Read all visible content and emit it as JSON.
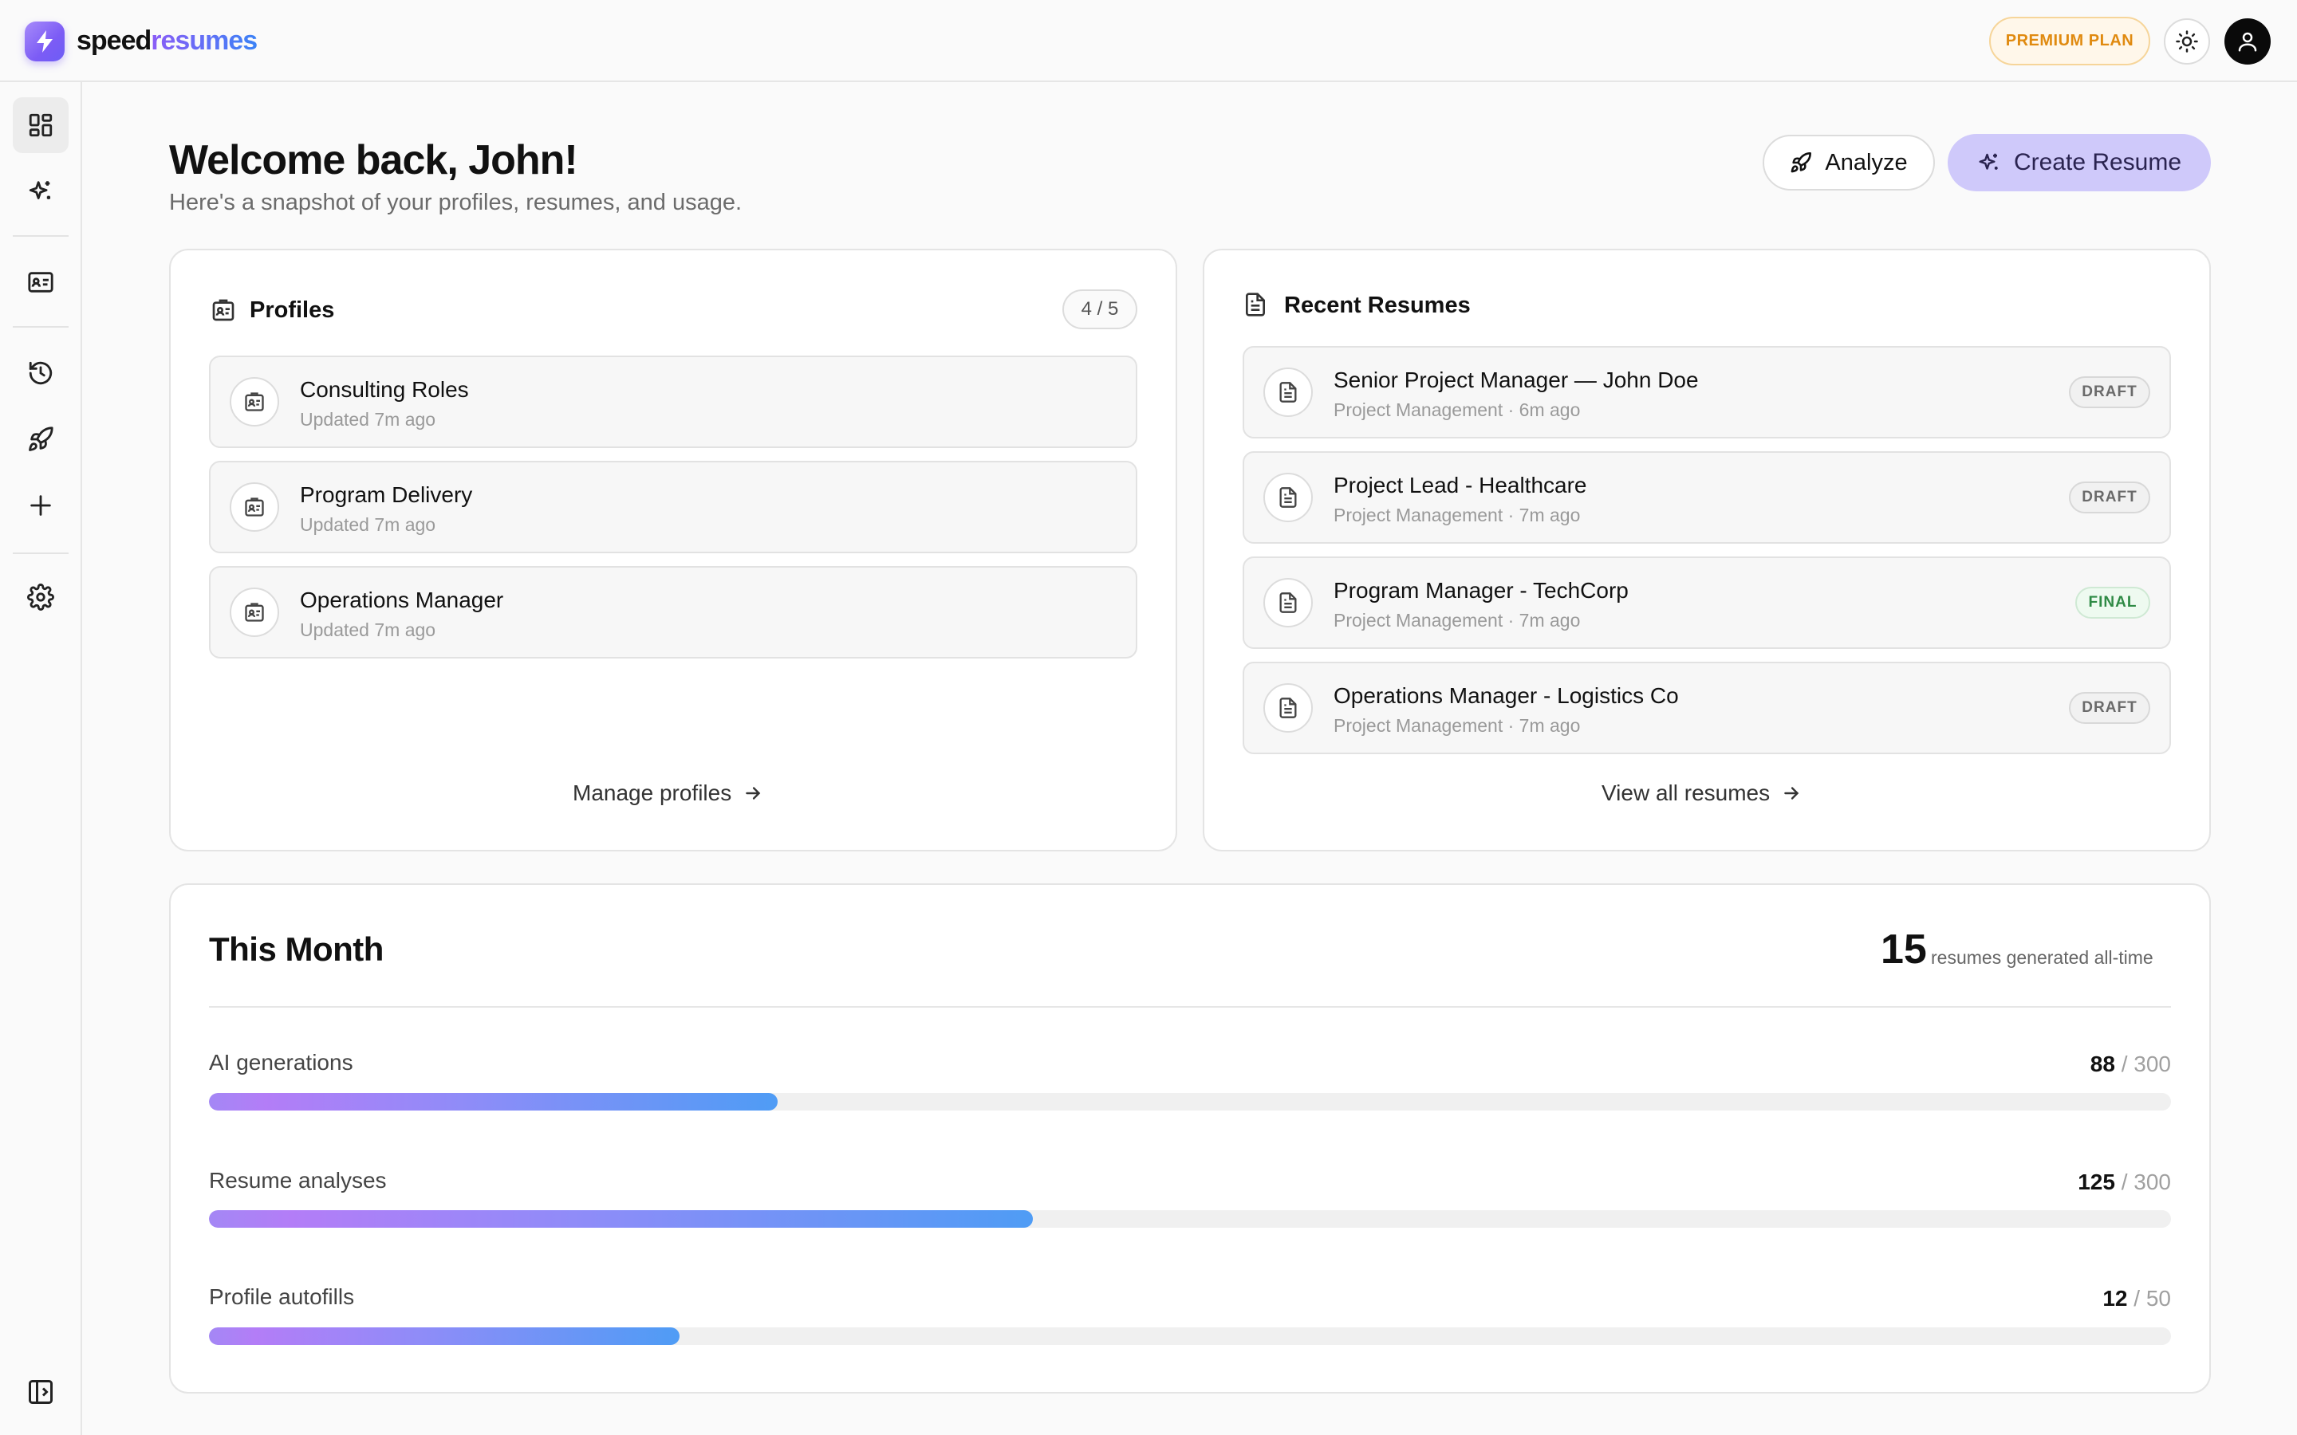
{
  "header": {
    "brand_part1": "speed",
    "brand_part2": "resumes",
    "plan_badge": "PREMIUM PLAN",
    "logo_icon": "lightning-bolt-icon",
    "theme_icon": "sun-icon",
    "avatar_icon": "user-icon"
  },
  "sidebar": {
    "items": [
      {
        "icon": "dashboard-icon",
        "active": true
      },
      {
        "icon": "sparkles-icon"
      },
      {
        "icon": "id-card-icon"
      },
      {
        "icon": "history-icon"
      },
      {
        "icon": "rocket-icon"
      },
      {
        "icon": "plus-icon"
      },
      {
        "icon": "settings-icon"
      }
    ],
    "collapse_icon": "sidebar-toggle-icon"
  },
  "main": {
    "title": "Welcome back, John!",
    "subtitle": "Here's a snapshot of your profiles, resumes, and usage.",
    "analyze_label": "Analyze",
    "create_label": "Create Resume"
  },
  "profiles": {
    "title": "Profiles",
    "count": "4 / 5",
    "items": [
      {
        "name": "Consulting Roles",
        "updated": "Updated 7m ago"
      },
      {
        "name": "Program Delivery",
        "updated": "Updated 7m ago"
      },
      {
        "name": "Operations Manager",
        "updated": "Updated 7m ago"
      }
    ],
    "manage_label": "Manage profiles"
  },
  "resumes": {
    "title": "Recent Resumes",
    "items": [
      {
        "name": "Senior Project Manager — John Doe",
        "meta": "Project Management · 6m ago",
        "status": "DRAFT"
      },
      {
        "name": "Project Lead - Healthcare",
        "meta": "Project Management · 7m ago",
        "status": "DRAFT"
      },
      {
        "name": "Program Manager - TechCorp",
        "meta": "Project Management · 7m ago",
        "status": "FINAL"
      },
      {
        "name": "Operations Manager - Logistics Co",
        "meta": "Project Management · 7m ago",
        "status": "DRAFT"
      }
    ],
    "view_all_label": "View all resumes"
  },
  "usage": {
    "title": "This Month",
    "alltime_count": "15",
    "alltime_label": "resumes generated all-time",
    "metrics": [
      {
        "label": "AI generations",
        "used": "88",
        "total": "/ 300",
        "fraction": 0.29
      },
      {
        "label": "Resume analyses",
        "used": "125",
        "total": "/ 300",
        "fraction": 0.42
      },
      {
        "label": "Profile autofills",
        "used": "12",
        "total": "/ 50",
        "fraction": 0.24
      }
    ]
  },
  "colors": {
    "accent": "#7c5cf5",
    "premium": "#e08a10",
    "final_green": "#2f8a45",
    "create_button_bg": "#cfc9fa"
  }
}
